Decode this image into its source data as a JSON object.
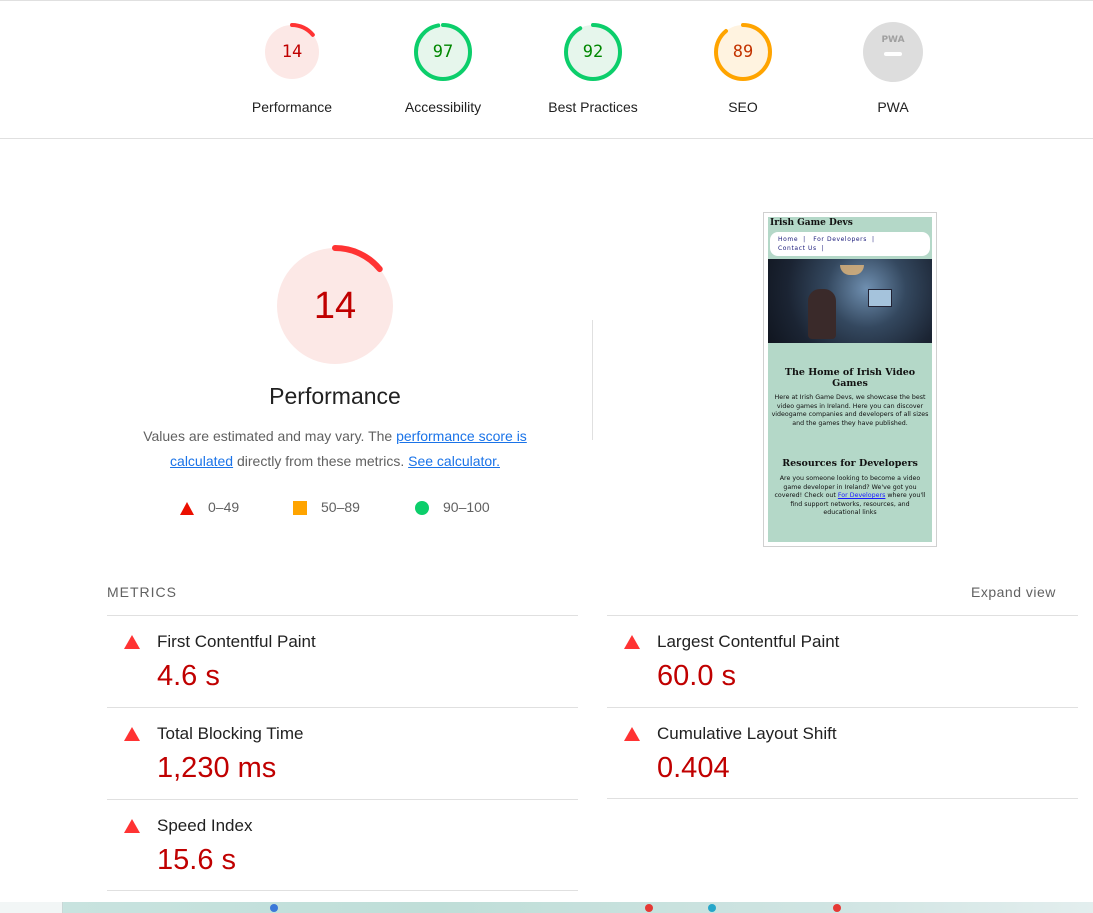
{
  "summary": {
    "gauges": [
      {
        "score": "14",
        "label": "Performance",
        "status": "fail",
        "fraction": 0.14,
        "color": "#c00000",
        "fill": "#fce8e6",
        "stroke": "#ff3333"
      },
      {
        "score": "97",
        "label": "Accessibility",
        "status": "pass",
        "fraction": 0.97,
        "color": "#008800",
        "fill": "#e6f6ec",
        "stroke": "#0cce6b"
      },
      {
        "score": "92",
        "label": "Best Practices",
        "status": "pass",
        "fraction": 0.92,
        "color": "#008800",
        "fill": "#e6f6ec",
        "stroke": "#0cce6b"
      },
      {
        "score": "89",
        "label": "SEO",
        "status": "average",
        "fraction": 0.89,
        "color": "#c33300",
        "fill": "#fff3e0",
        "stroke": "#ffa400"
      },
      {
        "score": "",
        "label": "PWA",
        "status": "na",
        "icon": "pwa-badge-icon"
      }
    ]
  },
  "performance": {
    "score": "14",
    "fraction": 0.14,
    "title": "Performance",
    "desc_before": "Values are estimated and may vary. The ",
    "link_score": "performance score is calculated",
    "desc_middle": " directly from these metrics. ",
    "link_calculator": "See calculator.",
    "legend": [
      {
        "range": "0–49",
        "icon": "fail-triangle-icon"
      },
      {
        "range": "50–89",
        "icon": "average-square-icon"
      },
      {
        "range": "90–100",
        "icon": "pass-circle-icon"
      }
    ]
  },
  "screenshot": {
    "brand": "Irish Game Devs",
    "nav": [
      "Home",
      "For Developers",
      "Contact Us"
    ],
    "heading1": "The Home of Irish Video Games",
    "para1": "Here at Irish Game Devs, we showcase the best video games in Ireland. Here you can discover videogame companies and developers of all sizes and the games they have published.",
    "heading2": "Resources for Developers",
    "para2_before": "Are you someone looking to become a video game developer in Ireland? We've got you covered! Check out ",
    "para2_link": "For Developers",
    "para2_after": " where you'll find support networks, resources, and educational links"
  },
  "metrics": {
    "header": "METRICS",
    "expand": "Expand view",
    "items": [
      {
        "title": "First Contentful Paint",
        "value": "4.6 s",
        "status": "fail"
      },
      {
        "title": "Largest Contentful Paint",
        "value": "60.0 s",
        "status": "fail"
      },
      {
        "title": "Total Blocking Time",
        "value": "1,230 ms",
        "status": "fail"
      },
      {
        "title": "Cumulative Layout Shift",
        "value": "0.404",
        "status": "fail"
      },
      {
        "title": "Speed Index",
        "value": "15.6 s",
        "status": "fail"
      }
    ]
  },
  "colors": {
    "fail": "#ff3333",
    "fail_text": "#c00000",
    "average": "#ffa400",
    "pass": "#0cce6b",
    "link": "#1a73e8"
  }
}
